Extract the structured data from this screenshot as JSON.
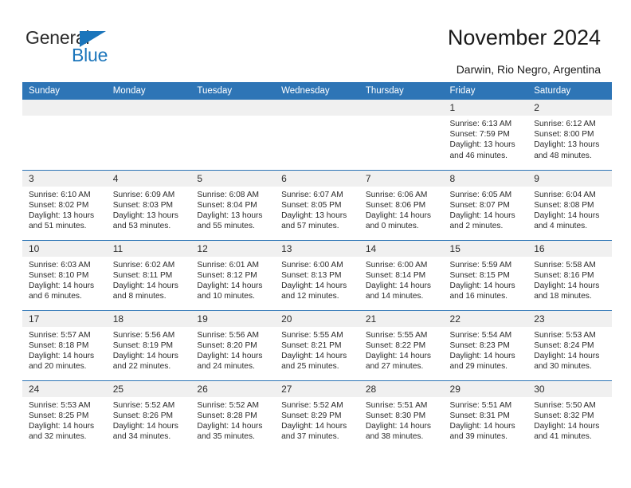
{
  "logo": {
    "word1": "General",
    "word2": "Blue",
    "triangle_color": "#1b75bb",
    "text_color": "#2b2b2b"
  },
  "header": {
    "title": "November 2024",
    "subtitle": "Darwin, Rio Negro, Argentina",
    "header_bg": "#2e75b6",
    "daynum_bg": "#f0f0f0"
  },
  "calendar": {
    "weekdays": [
      "Sunday",
      "Monday",
      "Tuesday",
      "Wednesday",
      "Thursday",
      "Friday",
      "Saturday"
    ],
    "weeks": [
      [
        {
          "day": "",
          "empty": true
        },
        {
          "day": "",
          "empty": true
        },
        {
          "day": "",
          "empty": true
        },
        {
          "day": "",
          "empty": true
        },
        {
          "day": "",
          "empty": true
        },
        {
          "day": "1",
          "sunrise": "Sunrise: 6:13 AM",
          "sunset": "Sunset: 7:59 PM",
          "daylight": "Daylight: 13 hours and 46 minutes."
        },
        {
          "day": "2",
          "sunrise": "Sunrise: 6:12 AM",
          "sunset": "Sunset: 8:00 PM",
          "daylight": "Daylight: 13 hours and 48 minutes."
        }
      ],
      [
        {
          "day": "3",
          "sunrise": "Sunrise: 6:10 AM",
          "sunset": "Sunset: 8:02 PM",
          "daylight": "Daylight: 13 hours and 51 minutes."
        },
        {
          "day": "4",
          "sunrise": "Sunrise: 6:09 AM",
          "sunset": "Sunset: 8:03 PM",
          "daylight": "Daylight: 13 hours and 53 minutes."
        },
        {
          "day": "5",
          "sunrise": "Sunrise: 6:08 AM",
          "sunset": "Sunset: 8:04 PM",
          "daylight": "Daylight: 13 hours and 55 minutes."
        },
        {
          "day": "6",
          "sunrise": "Sunrise: 6:07 AM",
          "sunset": "Sunset: 8:05 PM",
          "daylight": "Daylight: 13 hours and 57 minutes."
        },
        {
          "day": "7",
          "sunrise": "Sunrise: 6:06 AM",
          "sunset": "Sunset: 8:06 PM",
          "daylight": "Daylight: 14 hours and 0 minutes."
        },
        {
          "day": "8",
          "sunrise": "Sunrise: 6:05 AM",
          "sunset": "Sunset: 8:07 PM",
          "daylight": "Daylight: 14 hours and 2 minutes."
        },
        {
          "day": "9",
          "sunrise": "Sunrise: 6:04 AM",
          "sunset": "Sunset: 8:08 PM",
          "daylight": "Daylight: 14 hours and 4 minutes."
        }
      ],
      [
        {
          "day": "10",
          "sunrise": "Sunrise: 6:03 AM",
          "sunset": "Sunset: 8:10 PM",
          "daylight": "Daylight: 14 hours and 6 minutes."
        },
        {
          "day": "11",
          "sunrise": "Sunrise: 6:02 AM",
          "sunset": "Sunset: 8:11 PM",
          "daylight": "Daylight: 14 hours and 8 minutes."
        },
        {
          "day": "12",
          "sunrise": "Sunrise: 6:01 AM",
          "sunset": "Sunset: 8:12 PM",
          "daylight": "Daylight: 14 hours and 10 minutes."
        },
        {
          "day": "13",
          "sunrise": "Sunrise: 6:00 AM",
          "sunset": "Sunset: 8:13 PM",
          "daylight": "Daylight: 14 hours and 12 minutes."
        },
        {
          "day": "14",
          "sunrise": "Sunrise: 6:00 AM",
          "sunset": "Sunset: 8:14 PM",
          "daylight": "Daylight: 14 hours and 14 minutes."
        },
        {
          "day": "15",
          "sunrise": "Sunrise: 5:59 AM",
          "sunset": "Sunset: 8:15 PM",
          "daylight": "Daylight: 14 hours and 16 minutes."
        },
        {
          "day": "16",
          "sunrise": "Sunrise: 5:58 AM",
          "sunset": "Sunset: 8:16 PM",
          "daylight": "Daylight: 14 hours and 18 minutes."
        }
      ],
      [
        {
          "day": "17",
          "sunrise": "Sunrise: 5:57 AM",
          "sunset": "Sunset: 8:18 PM",
          "daylight": "Daylight: 14 hours and 20 minutes."
        },
        {
          "day": "18",
          "sunrise": "Sunrise: 5:56 AM",
          "sunset": "Sunset: 8:19 PM",
          "daylight": "Daylight: 14 hours and 22 minutes."
        },
        {
          "day": "19",
          "sunrise": "Sunrise: 5:56 AM",
          "sunset": "Sunset: 8:20 PM",
          "daylight": "Daylight: 14 hours and 24 minutes."
        },
        {
          "day": "20",
          "sunrise": "Sunrise: 5:55 AM",
          "sunset": "Sunset: 8:21 PM",
          "daylight": "Daylight: 14 hours and 25 minutes."
        },
        {
          "day": "21",
          "sunrise": "Sunrise: 5:55 AM",
          "sunset": "Sunset: 8:22 PM",
          "daylight": "Daylight: 14 hours and 27 minutes."
        },
        {
          "day": "22",
          "sunrise": "Sunrise: 5:54 AM",
          "sunset": "Sunset: 8:23 PM",
          "daylight": "Daylight: 14 hours and 29 minutes."
        },
        {
          "day": "23",
          "sunrise": "Sunrise: 5:53 AM",
          "sunset": "Sunset: 8:24 PM",
          "daylight": "Daylight: 14 hours and 30 minutes."
        }
      ],
      [
        {
          "day": "24",
          "sunrise": "Sunrise: 5:53 AM",
          "sunset": "Sunset: 8:25 PM",
          "daylight": "Daylight: 14 hours and 32 minutes."
        },
        {
          "day": "25",
          "sunrise": "Sunrise: 5:52 AM",
          "sunset": "Sunset: 8:26 PM",
          "daylight": "Daylight: 14 hours and 34 minutes."
        },
        {
          "day": "26",
          "sunrise": "Sunrise: 5:52 AM",
          "sunset": "Sunset: 8:28 PM",
          "daylight": "Daylight: 14 hours and 35 minutes."
        },
        {
          "day": "27",
          "sunrise": "Sunrise: 5:52 AM",
          "sunset": "Sunset: 8:29 PM",
          "daylight": "Daylight: 14 hours and 37 minutes."
        },
        {
          "day": "28",
          "sunrise": "Sunrise: 5:51 AM",
          "sunset": "Sunset: 8:30 PM",
          "daylight": "Daylight: 14 hours and 38 minutes."
        },
        {
          "day": "29",
          "sunrise": "Sunrise: 5:51 AM",
          "sunset": "Sunset: 8:31 PM",
          "daylight": "Daylight: 14 hours and 39 minutes."
        },
        {
          "day": "30",
          "sunrise": "Sunrise: 5:50 AM",
          "sunset": "Sunset: 8:32 PM",
          "daylight": "Daylight: 14 hours and 41 minutes."
        }
      ]
    ]
  }
}
